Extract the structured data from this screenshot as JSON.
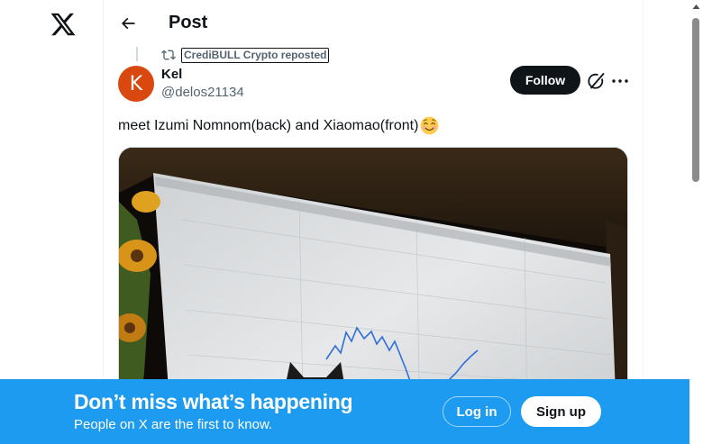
{
  "header": {
    "title": "Post"
  },
  "repost": {
    "label": "CrediBULL Crypto reposted"
  },
  "post": {
    "author_name": "Kel",
    "author_handle": "@delos21134",
    "avatar_initial": "K",
    "text": "meet Izumi Nomnom(back) and Xiaomao(front)",
    "emoji": "smiling-face-with-smiling-eyes",
    "follow_label": "Follow"
  },
  "banner": {
    "title": "Don’t miss what’s happening",
    "subtitle": "People on X are the first to know.",
    "login_label": "Log in",
    "signup_label": "Sign up"
  },
  "colors": {
    "accent": "#1d9bf0",
    "text_primary": "#0f1419",
    "text_secondary": "#536471",
    "avatar_bg": "#d9480f"
  },
  "icons": {
    "logo": "x-logo-icon",
    "back": "arrow-left-icon",
    "repost": "repost-icon",
    "grok": "grok-icon",
    "more": "more-icon"
  }
}
